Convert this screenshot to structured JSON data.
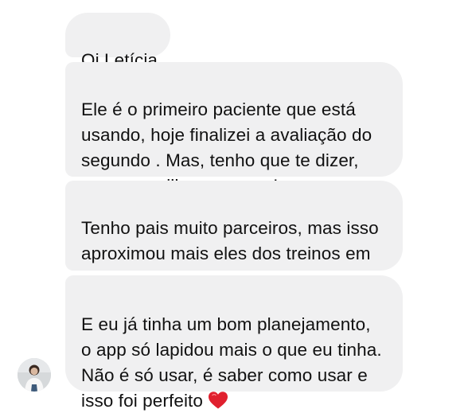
{
  "conversation": {
    "messages": [
      {
        "text": "Oi Letícia"
      },
      {
        "text": "Ele é o primeiro paciente que está\nusando, hoje finalizei a avaliação do\nsegundo . Mas, tenho que te dizer,\nque maravilha esse app!"
      },
      {
        "text": "Tenho pais muito parceiros, mas isso\naproximou mais eles dos treinos em\ncasa"
      },
      {
        "text": "E eu já tinha um bom planejamento,\no app só lapidou mais o que eu tinha.\nNão é só usar, é saber como usar e\nisso foi perfeito",
        "emoji": "heart-icon"
      }
    ]
  },
  "colors": {
    "bubble_background": "#f0f0f1",
    "text": "#111111",
    "heart": "#e0202e"
  },
  "sender": {
    "avatar_icon": "person-avatar"
  }
}
